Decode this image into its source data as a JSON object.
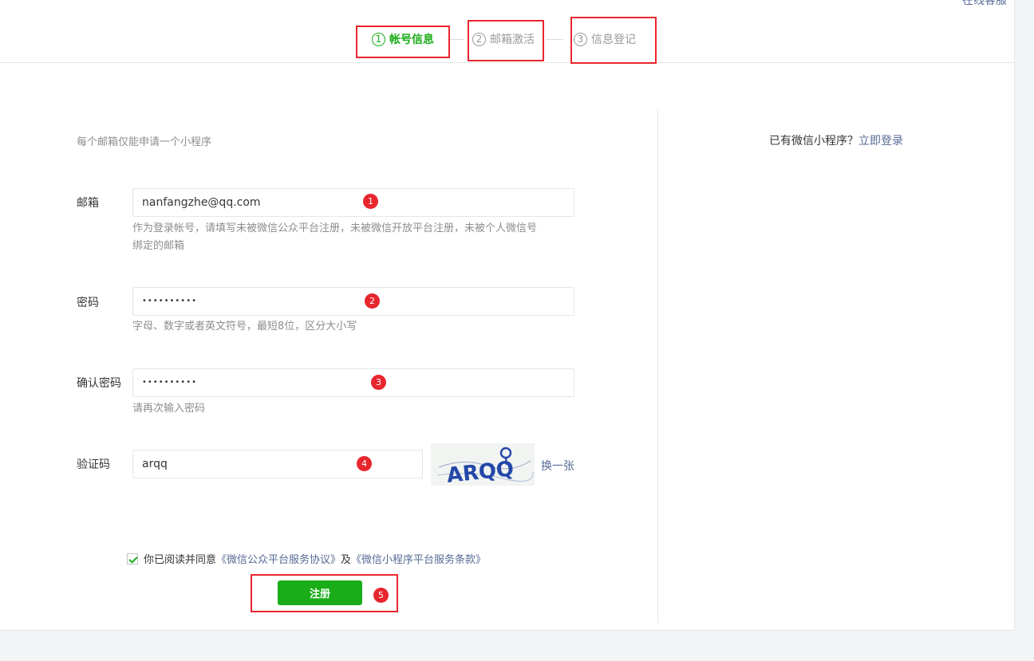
{
  "header": {
    "service_link": "在线客服"
  },
  "steps": [
    {
      "num": "1",
      "label": "帐号信息",
      "active": true
    },
    {
      "num": "2",
      "label": "邮箱激活",
      "active": false
    },
    {
      "num": "3",
      "label": "信息登记",
      "active": false
    }
  ],
  "form": {
    "tip": "每个邮箱仅能申请一个小程序",
    "email": {
      "label": "邮箱",
      "value": "nanfangzhe@qq.com",
      "hint_line1": "作为登录帐号，请填写未被微信公众平台注册，未被微信开放平台注册，未被个人微信号",
      "hint_line2": "绑定的邮箱"
    },
    "password": {
      "label": "密码",
      "value": "••••••••••",
      "hint": "字母、数字或者英文符号，最短8位，区分大小写"
    },
    "confirm_password": {
      "label": "确认密码",
      "value": "••••••••••",
      "hint": "请再次输入密码"
    },
    "captcha": {
      "label": "验证码",
      "value": "arqq",
      "image_text": "ARQQ",
      "refresh_label": "换一张"
    },
    "agreement": {
      "checked": true,
      "prefix": "你已阅读并同意",
      "link1": "《微信公众平台服务协议》",
      "middle": "及",
      "link2": "《微信小程序平台服务条款》"
    },
    "submit_label": "注册"
  },
  "side": {
    "existing_prefix": "已有微信小程序？",
    "login_link": "立即登录"
  },
  "annotations": [
    "1",
    "2",
    "3",
    "4",
    "5"
  ],
  "colors": {
    "accent": "#1aad19",
    "link": "#576b95",
    "annotation": "#e8262e"
  }
}
